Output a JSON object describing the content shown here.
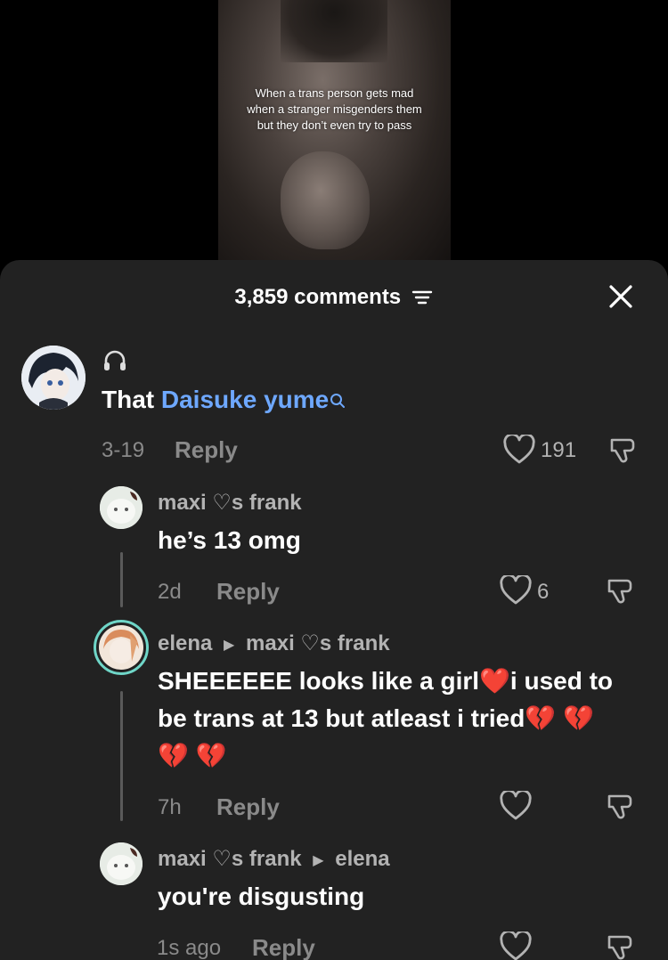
{
  "video": {
    "caption": "When a trans person gets mad when a stranger misgenders them but they don’t even try to pass"
  },
  "sheet": {
    "comments_count": "3,859 comments"
  },
  "comments": [
    {
      "text_prefix": "That ",
      "mention": "Daisuke yume",
      "date": "3-19",
      "reply_label": "Reply",
      "likes": "191"
    },
    {
      "name": "maxi ♡s frank",
      "text": "he’s 13 omg",
      "date": "2d",
      "reply_label": "Reply",
      "likes": "6"
    },
    {
      "name": "elena",
      "reply_to": "maxi ♡s frank",
      "text_line1": "SHEEEEEE looks like a girl",
      "text_line1b": "i used to",
      "text_line2": "be trans at 13 but atleast i tried",
      "date": "7h",
      "reply_label": "Reply"
    },
    {
      "name": "maxi ♡s frank",
      "reply_to": "elena",
      "text": "you're disgusting",
      "date": "1s ago",
      "reply_label": "Reply"
    }
  ],
  "emoji": {
    "red_heart": "❤️",
    "broken_heart": "💔"
  },
  "colors": {
    "sheet_bg": "#222222",
    "mention": "#6ea8ff",
    "muted": "#8a8a8a",
    "broken_heart": "#e0352f"
  }
}
